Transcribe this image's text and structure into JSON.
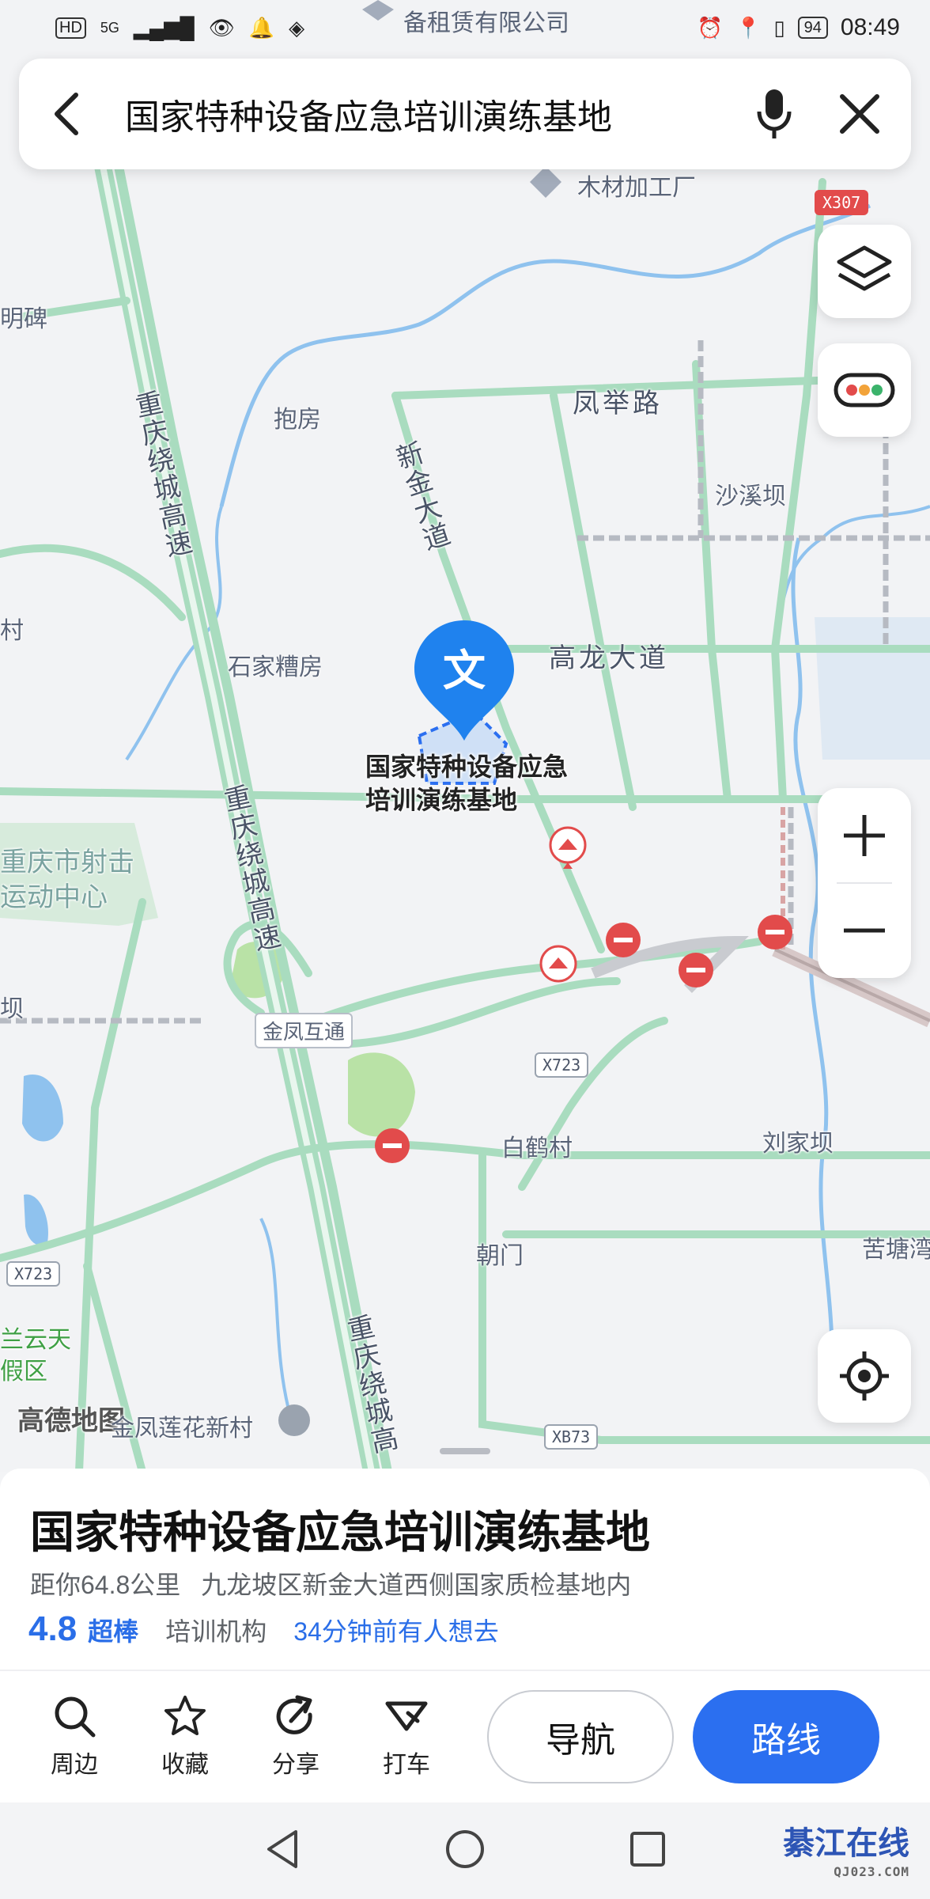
{
  "status_bar": {
    "left_icons": [
      "HD",
      "5G",
      "signal-icon",
      "eye-icon",
      "bell-icon",
      "shield-icon"
    ],
    "top_label": "备租赁有限公司",
    "battery": "94",
    "time": "08:49"
  },
  "search": {
    "query": "国家特种设备应急培训演练基地"
  },
  "map": {
    "labels": {
      "muchai": "木材加工厂",
      "mingbei": "明碑",
      "baofang": "抱房",
      "fengjulu": "凤举路",
      "xinjindadao": "新金大道",
      "shaxiba": "沙溪坝",
      "cun": "村",
      "shijiacaofang": "石家糟房",
      "gaolongdadao": "高龙大道",
      "cqhuancheng1": "重庆绕城高速",
      "cqhuancheng2": "重庆绕城高速",
      "cqhuancheng3": "重庆绕城高",
      "shejizhongxin": "重庆市射击运动中心",
      "jinfenghutong": "金凤互通",
      "ba": "坝",
      "baihecun": "白鹤村",
      "liujiaba": "刘家坝",
      "chaomen": "朝门",
      "kutang": "苦塘湾",
      "lanyuntian": "兰云天假区",
      "gaode": "高德地图",
      "lianhuaxincun": "金凤莲花新村"
    },
    "shields": {
      "x307": "X307",
      "x723a": "X723",
      "x723b": "X723",
      "xb73": "XB73"
    }
  },
  "pin": {
    "glyph": "文",
    "label": "国家特种设备应急培训演练基地"
  },
  "poi": {
    "title": "国家特种设备应急培训演练基地",
    "distance": "距你64.8公里",
    "address": "九龙坡区新金大道西侧国家质检基地内",
    "rating": "4.8",
    "rating_word": "超棒",
    "category": "培训机构",
    "popularity": "34分钟前有人想去"
  },
  "actions": {
    "nearby": "周边",
    "favorite": "收藏",
    "share": "分享",
    "taxi": "打车",
    "navigate": "导航",
    "route": "路线"
  },
  "watermark": {
    "name": "綦江在线",
    "url": "QJ023.COM"
  },
  "colors": {
    "accent": "#2b6ff0",
    "road_green": "#a9dcbf",
    "water": "#8fc2ee",
    "park": "#b9e2a6",
    "pin_blue": "#1f82ee"
  }
}
